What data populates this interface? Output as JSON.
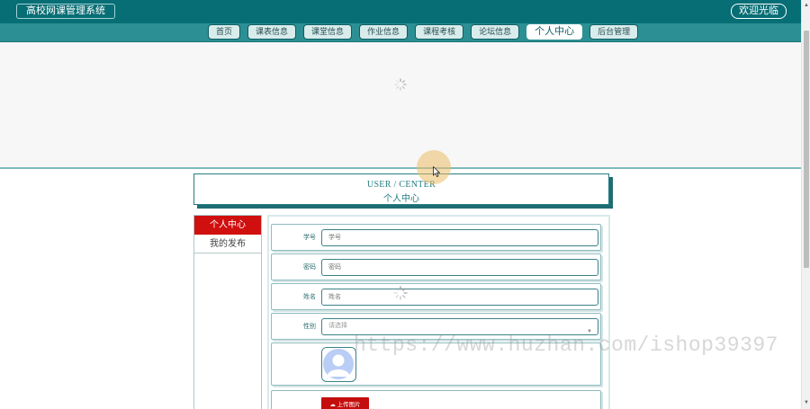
{
  "header": {
    "site_title": "高校网课管理系统",
    "welcome": "欢迎光临"
  },
  "nav": {
    "items": [
      {
        "label": "首页",
        "active": false
      },
      {
        "label": "课表信息",
        "active": false
      },
      {
        "label": "课堂信息",
        "active": false
      },
      {
        "label": "作业信息",
        "active": false
      },
      {
        "label": "课程考核",
        "active": false
      },
      {
        "label": "论坛信息",
        "active": false
      },
      {
        "label": "个人中心",
        "active": true
      },
      {
        "label": "后台管理",
        "active": false
      }
    ]
  },
  "page_title": {
    "en": "USER / CENTER",
    "cn": "个人中心"
  },
  "sidebar": {
    "items": [
      {
        "label": "个人中心",
        "active": true
      },
      {
        "label": "我的发布",
        "active": false
      }
    ]
  },
  "form": {
    "student_id": {
      "label": "学号",
      "placeholder": "学号"
    },
    "password": {
      "label": "密码",
      "placeholder": "密码"
    },
    "name": {
      "label": "姓名",
      "placeholder": "姓名"
    },
    "gender": {
      "label": "性别",
      "placeholder": "请选择"
    },
    "upload_label": "上传图片"
  },
  "watermark": "https://www.huzhan.com/ishop39397",
  "colors": {
    "header_bg": "#076e75",
    "nav_bg": "#2c8f93",
    "accent_red": "#d00f0f",
    "teal_text": "#247e83"
  },
  "icons": {
    "spinner": "loading-spinner-icon",
    "avatar": "user-avatar-icon",
    "upload": "cloud-upload-icon",
    "select": "chevron-down-icon"
  }
}
